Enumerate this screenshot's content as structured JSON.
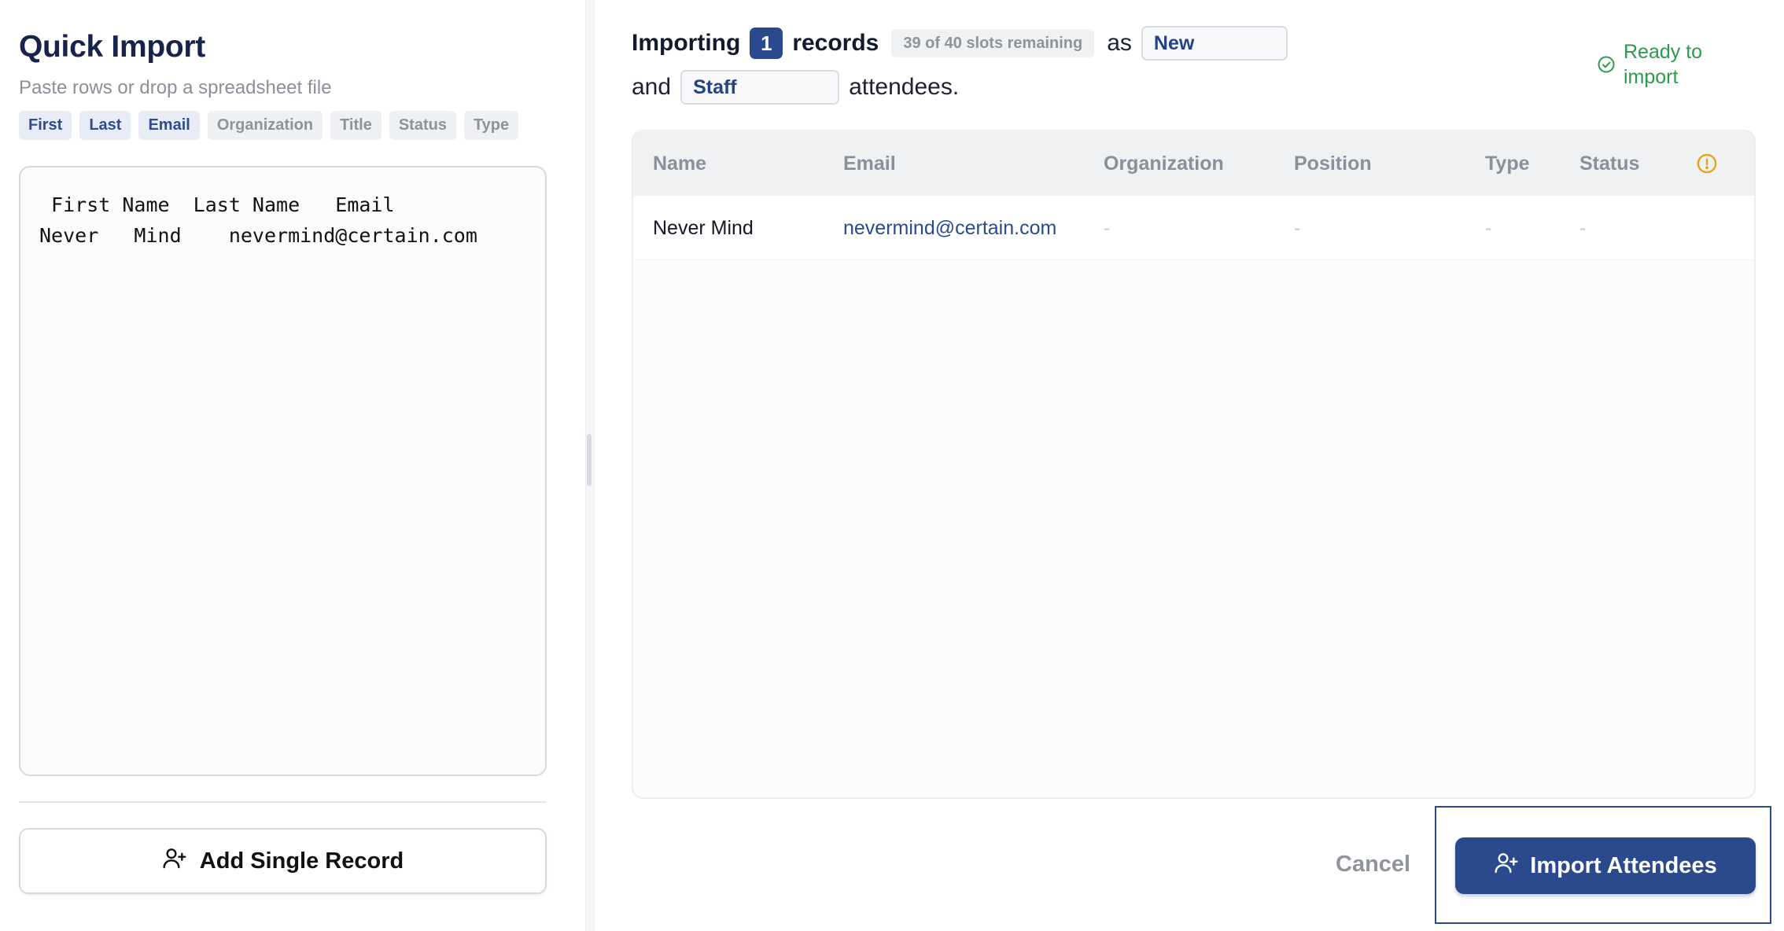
{
  "left": {
    "title": "Quick Import",
    "subtitle": "Paste rows or drop a spreadsheet file",
    "column_chips": [
      {
        "label": "First",
        "active": true
      },
      {
        "label": "Last",
        "active": true
      },
      {
        "label": "Email",
        "active": true
      },
      {
        "label": "Organization",
        "active": false
      },
      {
        "label": "Title",
        "active": false
      },
      {
        "label": "Status",
        "active": false
      },
      {
        "label": "Type",
        "active": false
      }
    ],
    "paste_text": " First Name  Last Name   Email\nNever   Mind    nevermind@certain.com",
    "add_single_label": "Add Single Record",
    "add_single_icon": "user-plus-icon"
  },
  "header": {
    "importing_label": "Importing",
    "count": "1",
    "records_label": "records",
    "slots_text": "39 of 40 slots remaining",
    "as_label": "as",
    "status_value": "New",
    "and_label": "and",
    "type_value": "Staff",
    "attendees_label": "attendees.",
    "ready_text": "Ready to\nimport",
    "ready_icon": "check-circle-icon"
  },
  "table": {
    "columns": [
      "Name",
      "Email",
      "Organization",
      "Position",
      "Type",
      "Status"
    ],
    "warning_icon": "alert-circle-icon",
    "rows": [
      {
        "name": "Never Mind",
        "email": "nevermind@certain.com",
        "organization": "-",
        "position": "-",
        "type": "-",
        "status": "-"
      }
    ]
  },
  "footer": {
    "cancel_label": "Cancel",
    "import_label": "Import Attendees",
    "import_icon": "user-plus-icon"
  },
  "colors": {
    "brand": "#2b4a8e",
    "success": "#2c9a4c",
    "warning": "#e0a414",
    "link": "#2a4a92"
  }
}
